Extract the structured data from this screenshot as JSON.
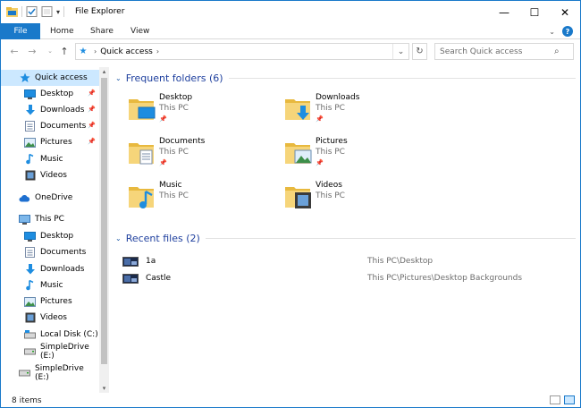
{
  "window": {
    "title": "File Explorer",
    "controls": {
      "minimize": "—",
      "maximize": "☐",
      "close": "✕"
    }
  },
  "ribbon": {
    "file_tab": "File",
    "tabs": [
      "Home",
      "Share",
      "View"
    ]
  },
  "address": {
    "breadcrumb": "Quick access",
    "search_placeholder": "Search Quick access"
  },
  "nav_pane": {
    "items": [
      {
        "label": "Quick access",
        "icon": "quick-access-star-icon",
        "selected": true,
        "pinned": false,
        "indent": 0
      },
      {
        "label": "Desktop",
        "icon": "desktop-icon",
        "pinned": true,
        "indent": 1
      },
      {
        "label": "Downloads",
        "icon": "downloads-icon",
        "pinned": true,
        "indent": 1
      },
      {
        "label": "Documents",
        "icon": "documents-icon",
        "pinned": true,
        "indent": 1
      },
      {
        "label": "Pictures",
        "icon": "pictures-icon",
        "pinned": true,
        "indent": 1
      },
      {
        "label": "Music",
        "icon": "music-icon",
        "pinned": false,
        "indent": 1
      },
      {
        "label": "Videos",
        "icon": "videos-icon",
        "pinned": false,
        "indent": 1
      },
      {
        "label": "OneDrive",
        "icon": "onedrive-icon",
        "pinned": false,
        "indent": 0
      },
      {
        "label": "This PC",
        "icon": "this-pc-icon",
        "pinned": false,
        "indent": 0
      },
      {
        "label": "Desktop",
        "icon": "desktop-icon",
        "pinned": false,
        "indent": 1
      },
      {
        "label": "Documents",
        "icon": "documents-icon",
        "pinned": false,
        "indent": 1
      },
      {
        "label": "Downloads",
        "icon": "downloads-icon",
        "pinned": false,
        "indent": 1
      },
      {
        "label": "Music",
        "icon": "music-icon",
        "pinned": false,
        "indent": 1
      },
      {
        "label": "Pictures",
        "icon": "pictures-icon",
        "pinned": false,
        "indent": 1
      },
      {
        "label": "Videos",
        "icon": "videos-icon",
        "pinned": false,
        "indent": 1
      },
      {
        "label": "Local Disk (C:)",
        "icon": "local-disk-icon",
        "pinned": false,
        "indent": 1
      },
      {
        "label": "SimpleDrive (E:)",
        "icon": "drive-icon",
        "pinned": false,
        "indent": 1
      },
      {
        "label": "SimpleDrive (E:)",
        "icon": "drive-icon",
        "pinned": false,
        "indent": 0
      }
    ]
  },
  "frequent": {
    "title": "Frequent folders (6)",
    "folders": [
      {
        "name": "Desktop",
        "location": "This PC",
        "pinned": true,
        "overlay": "desktop-icon"
      },
      {
        "name": "Downloads",
        "location": "This PC",
        "pinned": true,
        "overlay": "downloads-icon"
      },
      {
        "name": "Documents",
        "location": "This PC",
        "pinned": true,
        "overlay": "documents-icon"
      },
      {
        "name": "Pictures",
        "location": "This PC",
        "pinned": true,
        "overlay": "pictures-icon"
      },
      {
        "name": "Music",
        "location": "This PC",
        "pinned": false,
        "overlay": "music-icon"
      },
      {
        "name": "Videos",
        "location": "This PC",
        "pinned": false,
        "overlay": "videos-icon"
      }
    ]
  },
  "recent": {
    "title": "Recent files (2)",
    "files": [
      {
        "name": "1a",
        "path": "This PC\\Desktop"
      },
      {
        "name": "Castle",
        "path": "This PC\\Pictures\\Desktop Backgrounds"
      }
    ]
  },
  "status": {
    "count": "8 items"
  },
  "colors": {
    "accent": "#1979ca",
    "folder": "#f4cf6a",
    "group_title": "#1e3f9e",
    "selected": "#cce8ff"
  }
}
